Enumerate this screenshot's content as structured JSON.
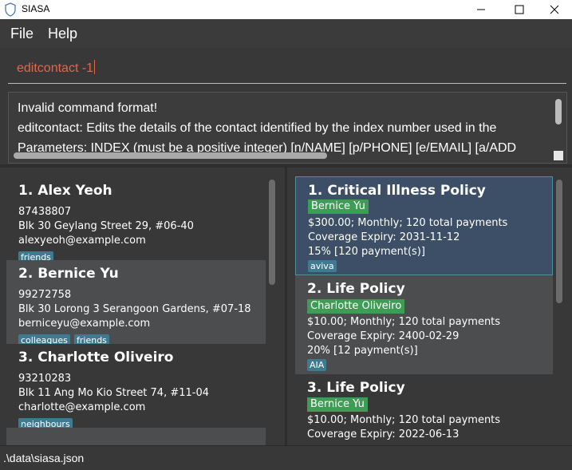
{
  "window": {
    "title": "SIASA",
    "icon": "shield-icon"
  },
  "menu": {
    "file": "File",
    "help": "Help"
  },
  "command": {
    "value": "editcontact -1"
  },
  "result": {
    "line1": "Invalid command format!",
    "line2": "editcontact: Edits the details of the contact identified by the index number used in the",
    "line3": "Parameters: INDEX (must be a positive integer) [n/NAME] [p/PHONE] [e/EMAIL] [a/ADD"
  },
  "contacts": [
    {
      "title": "1.  Alex Yeoh",
      "phone": "87438807",
      "address": "Blk 30 Geylang Street 29, #06-40",
      "email": "alexyeoh@example.com",
      "tags": [
        "friends"
      ]
    },
    {
      "title": "2.  Bernice Yu",
      "phone": "99272758",
      "address": "Blk 30 Lorong 3 Serangoon Gardens, #07-18",
      "email": "berniceyu@example.com",
      "tags": [
        "colleagues",
        "friends"
      ]
    },
    {
      "title": "3.  Charlotte Oliveiro",
      "phone": "93210283",
      "address": "Blk 11 Ang Mo Kio Street 74, #11-04",
      "email": "charlotte@example.com",
      "tags": [
        "neighbours"
      ]
    }
  ],
  "policies": [
    {
      "title": "1.  Critical Illness Policy",
      "owner": "Bernice Yu",
      "payment": "$300.00; Monthly; 120 total payments",
      "expiry": "Coverage Expiry: 2031-11-12",
      "commission": "15% [120 payment(s)]",
      "tag": "aviva"
    },
    {
      "title": "2.  Life Policy",
      "owner": "Charlotte Oliveiro",
      "payment": "$10.00; Monthly; 120 total payments",
      "expiry": "Coverage Expiry: 2400-02-29",
      "commission": "20% [12 payment(s)]",
      "tag": "AIA"
    },
    {
      "title": "3.  Life Policy",
      "owner": "Bernice Yu",
      "payment": "$10.00; Monthly; 120 total payments",
      "expiry": "Coverage Expiry: 2022-06-13"
    }
  ],
  "status": {
    "path": ".\\data\\siasa.json"
  },
  "colors": {
    "background": "#383838",
    "command_text": "#e0674f",
    "tag": "#3e7b91",
    "owner_tag": "#3e9d55",
    "selected_card": "#3c4f66"
  }
}
